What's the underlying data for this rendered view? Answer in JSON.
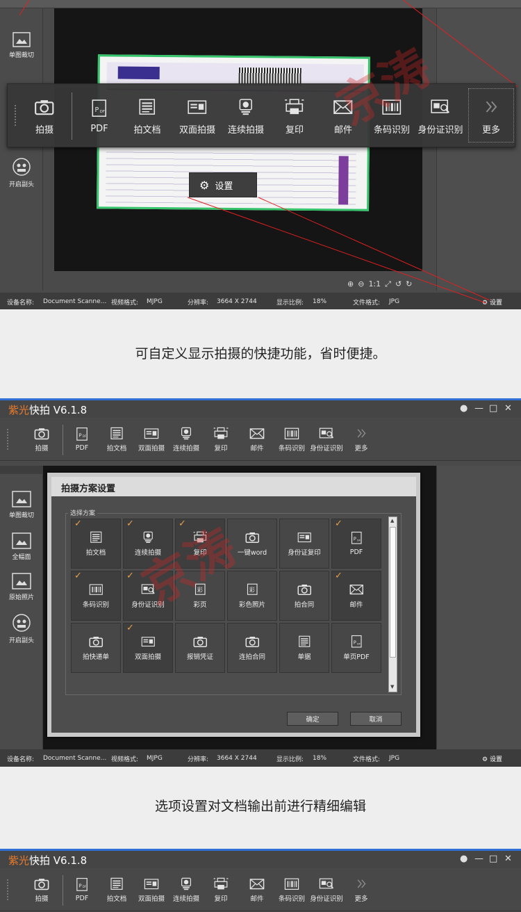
{
  "section1": {
    "sidebar": [
      {
        "label": "单图裁切"
      },
      {
        "label": "开启副头"
      }
    ],
    "toolbar": [
      {
        "label": "拍摄",
        "icon": "camera-icon"
      },
      {
        "label": "PDF",
        "icon": "pdf-icon"
      },
      {
        "label": "拍文档",
        "icon": "document-icon"
      },
      {
        "label": "双面拍摄",
        "icon": "id-card-icon"
      },
      {
        "label": "连续拍摄",
        "icon": "burst-camera-icon"
      },
      {
        "label": "复印",
        "icon": "printer-icon"
      },
      {
        "label": "邮件",
        "icon": "mail-icon"
      },
      {
        "label": "条码识别",
        "icon": "barcode-icon"
      },
      {
        "label": "身份证识别",
        "icon": "id-scan-icon"
      },
      {
        "label": "更多",
        "icon": "chevron-right-icon"
      }
    ],
    "settings_popup": "设置",
    "zoom_tools": [
      "⊕",
      "⊖",
      "1:1",
      "⤢",
      "↺",
      "↻"
    ]
  },
  "status": {
    "device_label": "设备名称:",
    "device_value": "Document Scanne...",
    "video_label": "视频格式:",
    "video_value": "MJPG",
    "res_label": "分辨率:",
    "res_value": "3664 X 2744",
    "ratio_label": "显示比例:",
    "ratio_value": "18%",
    "format_label": "文件格式:",
    "format_value": "JPG",
    "settings": "设置"
  },
  "caption1": "可自定义显示拍摄的快捷功能，省时便捷。",
  "caption2": "选项设置对文档输出前进行精细编辑",
  "window": {
    "brand": "紫光",
    "title": "快拍 V6.1.8",
    "controls": [
      "●",
      "—",
      "□",
      "✕"
    ],
    "toolbar": [
      {
        "label": "拍摄",
        "icon": "camera-icon"
      },
      {
        "label": "PDF",
        "icon": "pdf-icon"
      },
      {
        "label": "拍文档",
        "icon": "document-icon"
      },
      {
        "label": "双面拍摄",
        "icon": "id-card-icon"
      },
      {
        "label": "连续拍摄",
        "icon": "burst-camera-icon"
      },
      {
        "label": "复印",
        "icon": "printer-icon"
      },
      {
        "label": "邮件",
        "icon": "mail-icon"
      },
      {
        "label": "条码识别",
        "icon": "barcode-icon"
      },
      {
        "label": "身份证识别",
        "icon": "id-scan-icon"
      },
      {
        "label": "更多",
        "icon": "chevron-right-icon"
      }
    ],
    "sidebar": [
      {
        "label": "单图裁切"
      },
      {
        "label": "全幅面"
      },
      {
        "label": "原始照片"
      },
      {
        "label": "开启副头"
      }
    ]
  },
  "dialog": {
    "title": "拍摄方案设置",
    "group": "选择方案",
    "tiles": [
      {
        "label": "拍文档",
        "checked": true,
        "icon": "document-icon"
      },
      {
        "label": "连续拍摄",
        "checked": true,
        "icon": "burst-camera-icon"
      },
      {
        "label": "复印",
        "checked": true,
        "icon": "printer-icon"
      },
      {
        "label": "一键word",
        "checked": false,
        "icon": "camera-icon"
      },
      {
        "label": "身份证复印",
        "checked": false,
        "icon": "id-card-icon"
      },
      {
        "label": "PDF",
        "checked": true,
        "icon": "pdf-icon"
      },
      {
        "label": "条码识别",
        "checked": true,
        "icon": "barcode-icon"
      },
      {
        "label": "身份证识别",
        "checked": true,
        "icon": "id-scan-icon"
      },
      {
        "label": "彩页",
        "checked": false,
        "icon": "color-page-icon"
      },
      {
        "label": "彩色照片",
        "checked": false,
        "icon": "color-page-icon"
      },
      {
        "label": "拍合同",
        "checked": false,
        "icon": "camera-icon"
      },
      {
        "label": "邮件",
        "checked": true,
        "icon": "mail-icon"
      },
      {
        "label": "拍快递单",
        "checked": false,
        "icon": "camera-icon"
      },
      {
        "label": "双面拍摄",
        "checked": true,
        "icon": "id-card-icon"
      },
      {
        "label": "报销凭证",
        "checked": false,
        "icon": "camera-icon"
      },
      {
        "label": "连拍合同",
        "checked": false,
        "icon": "camera-icon"
      },
      {
        "label": "单据",
        "checked": false,
        "icon": "document-icon"
      },
      {
        "label": "单页PDF",
        "checked": false,
        "icon": "pdf-icon"
      }
    ],
    "ok": "确定",
    "cancel": "取消"
  },
  "colors": {
    "accent_blue": "#2f6fd6",
    "brand_orange": "#e87b2c",
    "check": "#e8a14a",
    "frame_green": "#35c46b"
  }
}
